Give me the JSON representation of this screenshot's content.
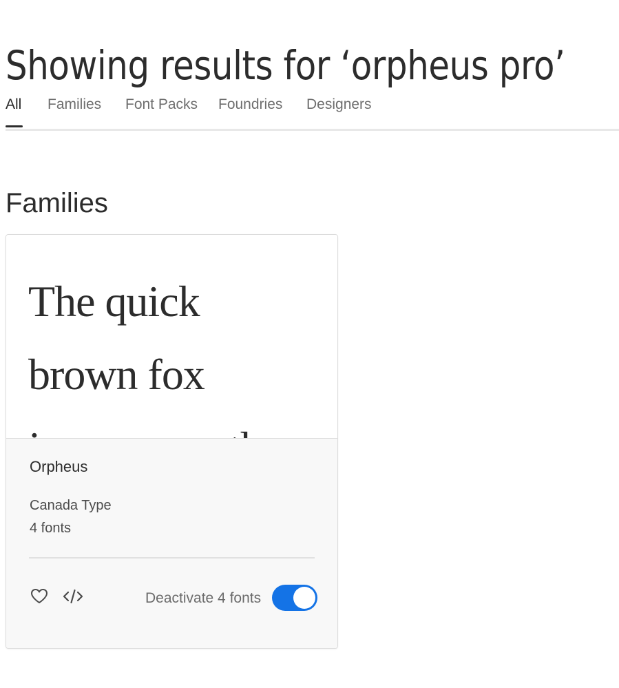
{
  "header": {
    "title": "Showing results for ‘orpheus pro’"
  },
  "tabs": [
    {
      "label": "All",
      "active": true
    },
    {
      "label": "Families",
      "active": false
    },
    {
      "label": "Font Packs",
      "active": false
    },
    {
      "label": "Foundries",
      "active": false
    },
    {
      "label": "Designers",
      "active": false
    }
  ],
  "section": {
    "heading": "Families"
  },
  "family_card": {
    "preview_text": "The quick brown fox jumps over the lazy dog",
    "name": "Orpheus",
    "foundry": "Canada Type",
    "font_count": "4 fonts",
    "favorite_icon": "heart-icon",
    "embed_icon": "code-icon",
    "toggle_label": "Deactivate 4 fonts",
    "toggle_on": true,
    "toggle_color": "#1473e6"
  }
}
